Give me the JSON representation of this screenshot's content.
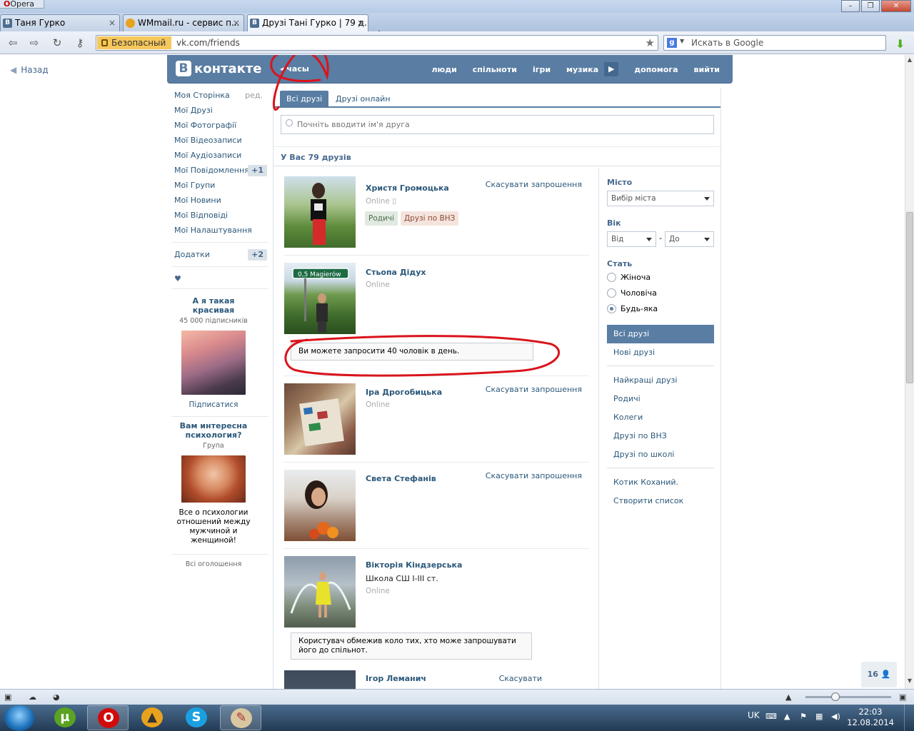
{
  "opera": {
    "menu_label": "Opera"
  },
  "tabs": [
    {
      "label": "Таня Гурко",
      "favicon": "В"
    },
    {
      "label": "WMmail.ru - сервис п...",
      "favicon": ""
    },
    {
      "label": "Друзі Тані Гурко | 79 д...",
      "favicon": "В"
    }
  ],
  "toolbar": {
    "security_label": "Безопасный",
    "url": "vk.com/friends",
    "search_placeholder": "Искать в Google",
    "search_engine_letter": "g"
  },
  "page": {
    "back_label": "Назад",
    "logo_text": "контакте",
    "logo_letter": "В",
    "clock_label": "часы",
    "top_nav": [
      "люди",
      "спільноти",
      "ігри",
      "музика",
      "допомога",
      "вийти"
    ]
  },
  "left_menu": {
    "items": [
      {
        "label": "Моя Сторінка",
        "extra": "ред."
      },
      {
        "label": "Мої Друзі"
      },
      {
        "label": "Мої Фотографії"
      },
      {
        "label": "Мої Відеозаписи"
      },
      {
        "label": "Мої Аудіозаписи"
      },
      {
        "label": "Мої Повідомлення",
        "count": "+1"
      },
      {
        "label": "Мої Групи"
      },
      {
        "label": "Мої Новини"
      },
      {
        "label": "Мої Відповіді"
      },
      {
        "label": "Мої Налаштування"
      }
    ],
    "apps": {
      "label": "Додатки",
      "count": "+2"
    },
    "heart": "♥",
    "ads": [
      {
        "title": "А я такая красивая",
        "subtitle": "45 000 підписників",
        "link": "Підписатися"
      },
      {
        "title": "Вам интересна психология?",
        "subtitle": "Група",
        "description": "Все о психологии отношений между мужчиной и женщиной!"
      }
    ],
    "all_ads": "Всі оголошення"
  },
  "friends": {
    "tabs": [
      "Всі друзі",
      "Друзі онлайн"
    ],
    "search_placeholder": "Почніть вводити ім'я друга",
    "count_label": "У Вас 79 друзів",
    "cancel_label": "Скасувати запрошення",
    "online_label": "Online",
    "list": [
      {
        "name": "Христя Громоцька",
        "tags": [
          "Родичі",
          "Друзі по ВНЗ"
        ]
      },
      {
        "name": "Стьопа Дідух",
        "photo_sign": "0,5 Magierów",
        "note": "Ви можете запросити 40 чоловік в день."
      },
      {
        "name": "Іра Дрогобицька"
      },
      {
        "name": "Света Стефанів"
      },
      {
        "name": "Вікторія Кіндзерська",
        "school": "Школа СШ І-ІІІ ст.",
        "note": "Користувач обмежив коло тих, хто може запрошувати його до спільнот."
      },
      {
        "name": "Ігор Леманич",
        "cancel": "Скасувати"
      }
    ]
  },
  "filters": {
    "city_label": "Місто",
    "city_select": "Вибір міста",
    "age_label": "Вік",
    "age_from": "Від",
    "age_sep": "-",
    "age_to": "До",
    "sex_label": "Стать",
    "sex_options": [
      "Жіноча",
      "Чоловіча",
      "Будь-яка"
    ],
    "sex_selected": "Будь-яка",
    "lists": [
      "Всі друзі",
      "Нові друзі",
      "Найкращі друзі",
      "Родичі",
      "Колеги",
      "Друзі по ВНЗ",
      "Друзі по школі",
      "Котик Коханий.",
      "Створити список"
    ]
  },
  "corner_counter": "16",
  "taskbar": {
    "lang": "UK",
    "time": "22:03",
    "date": "12.08.2014"
  },
  "colors": {
    "vk_blue": "#597da3",
    "link": "#2b587a",
    "annotation_red": "#d9141c"
  }
}
